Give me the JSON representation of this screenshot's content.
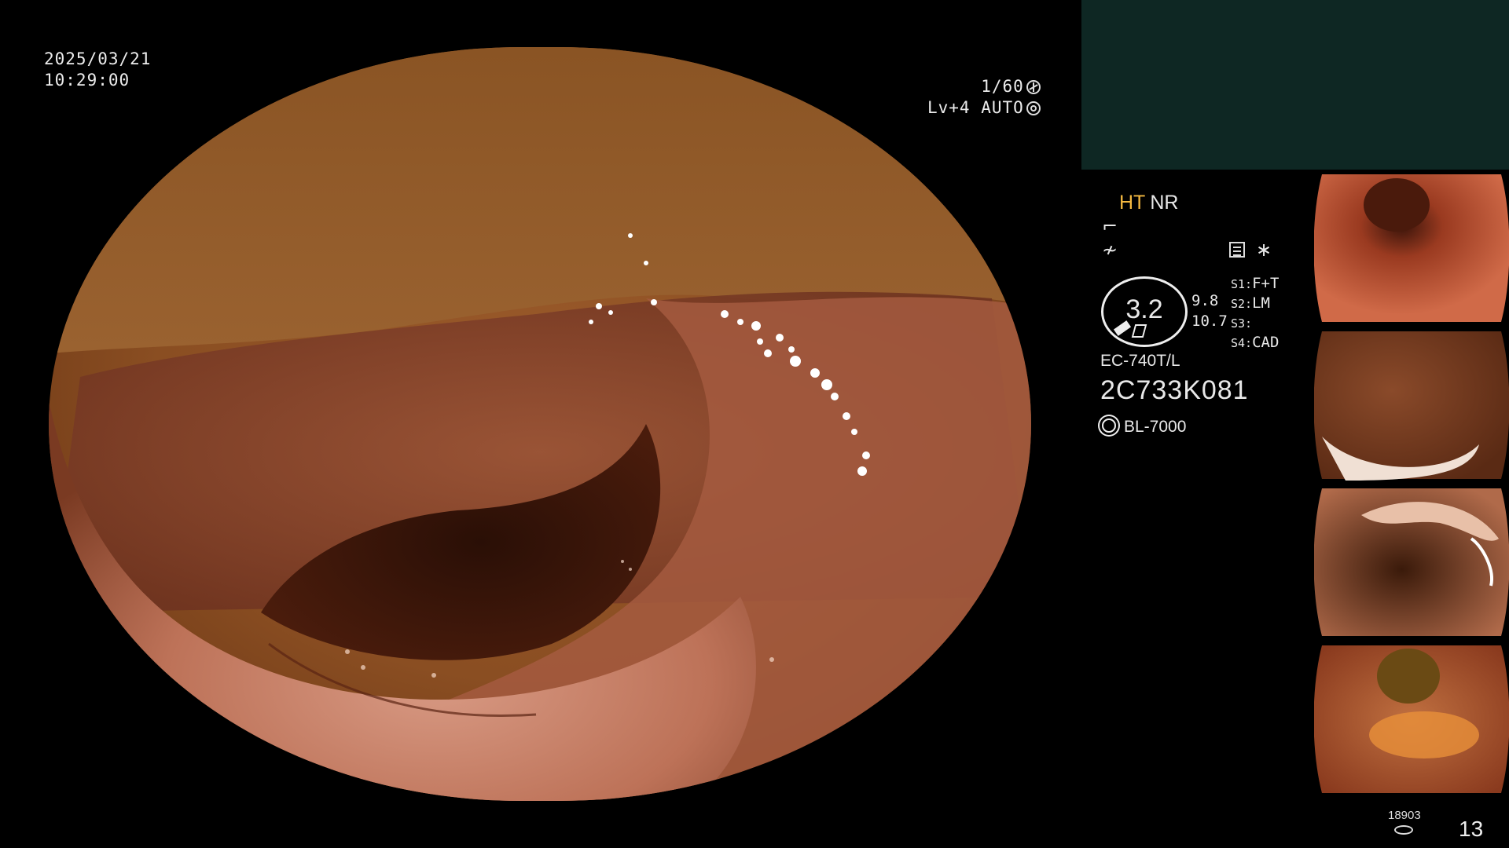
{
  "overlay": {
    "date": "2025/03/21",
    "time": "10:29:00",
    "shutter": "1/60",
    "light_level": "Lv+4",
    "exposure_mode": "AUTO"
  },
  "modes": {
    "ht": "HT",
    "nr": "NR"
  },
  "zoom": {
    "value": "3.2",
    "sec1": "9.8",
    "sec2": "10.7"
  },
  "switches": [
    {
      "key": "S1:",
      "value": "F+T"
    },
    {
      "key": "S2:",
      "value": "LM"
    },
    {
      "key": "S3:",
      "value": ""
    },
    {
      "key": "S4:",
      "value": "CAD"
    }
  ],
  "scope": {
    "model": "EC-740T/L",
    "serial": "2C733K081"
  },
  "light_source": "BL-7000",
  "counters": {
    "image_count": "18903",
    "captures": "13"
  },
  "icons": [
    "shutter-icon",
    "auto-iris-icon",
    "enhance-curve-icon",
    "edge-icon",
    "settings-panel-icon",
    "asterisk-icon",
    "pencil-icon",
    "frame-icon",
    "light-source-icon",
    "disk-icon"
  ],
  "colors": {
    "ht_accent": "#f4b840",
    "panel_bg": "#0e2723"
  }
}
